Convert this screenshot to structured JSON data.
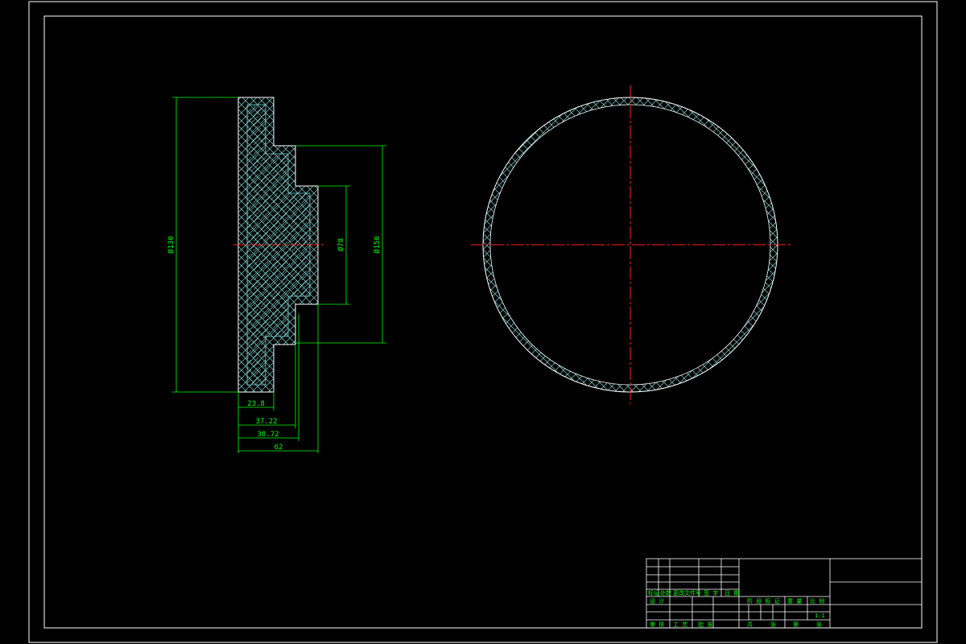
{
  "drawing": {
    "side_view": {
      "dimensions": {
        "overall_diameter": "Ø130",
        "step_diameter": "Ø150",
        "boss_diameter": "Ø78",
        "width_1": "23.8",
        "width_2": "37.22",
        "width_3": "38.72",
        "width_4": "62"
      }
    },
    "title_block": {
      "labels": [
        "标记",
        "处数",
        "更改文件号",
        "签 字",
        "日 期",
        "设 计",
        "阶 段 标 记",
        "重 量",
        "比 例",
        "审 核",
        "工 艺",
        "批 准",
        "共",
        "张",
        "第",
        "张",
        "1:1"
      ]
    }
  },
  "colors": {
    "background": "#000000",
    "frame": "#ffffff",
    "outline": "#ffffff",
    "hatch": "#7fd3d3",
    "section_hatch": "#88cccc",
    "dimension": "#00ff00",
    "centerline": "#ff2020"
  }
}
